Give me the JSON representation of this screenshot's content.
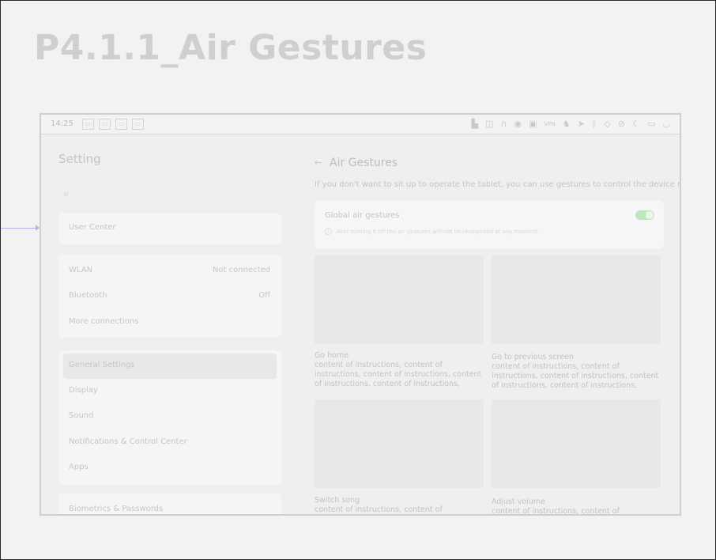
{
  "page_title": "P4.1.1_Air Gestures",
  "status_bar": {
    "time": "14:25",
    "notification_icons": [
      "notif-icon-1",
      "notif-icon-2",
      "notif-icon-3",
      "notif-icon-4"
    ],
    "system_icons": [
      {
        "name": "signal-sim-icon",
        "glyph": "▙"
      },
      {
        "name": "book-icon",
        "glyph": "◫"
      },
      {
        "name": "headphones-icon",
        "glyph": "∩"
      },
      {
        "name": "record-icon",
        "glyph": "◉"
      },
      {
        "name": "hd-icon",
        "glyph": "▣"
      },
      {
        "name": "vpn-icon",
        "glyph": "VPN"
      },
      {
        "name": "cat-icon",
        "glyph": "♞"
      },
      {
        "name": "location-icon",
        "glyph": "➤"
      },
      {
        "name": "bluetooth-icon",
        "glyph": "ᛒ"
      },
      {
        "name": "shield-icon",
        "glyph": "◇"
      },
      {
        "name": "alarm-off-icon",
        "glyph": "⊘"
      },
      {
        "name": "moon-icon",
        "glyph": "☾"
      },
      {
        "name": "battery-icon",
        "glyph": "▭"
      },
      {
        "name": "wifi-icon",
        "glyph": "◡"
      }
    ]
  },
  "sidebar": {
    "title": "Setting",
    "search_placeholder": "",
    "user_center": "User Center",
    "network": [
      {
        "label": "WLAN",
        "value": "Not connected"
      },
      {
        "label": "Bluetooth",
        "value": "Off"
      },
      {
        "label": "More connections",
        "value": ""
      }
    ],
    "general": [
      {
        "label": "General Settings",
        "active": true
      },
      {
        "label": "Display"
      },
      {
        "label": "Sound"
      },
      {
        "label": "Notifications & Control Center"
      },
      {
        "label": "Apps"
      }
    ],
    "security": [
      {
        "label": "Biometrics & Passwords"
      }
    ]
  },
  "main": {
    "back_glyph": "←",
    "title": "Air Gestures",
    "intro": "If you don't want to sit up to operate the tablet, you can use gestures to control the device remotely.",
    "global": {
      "title": "Global air gestures",
      "enabled": true,
      "note": "After turning it off the air gestures will not be recognized at any moment."
    },
    "gestures": [
      {
        "name": "Go home",
        "description": "content of instructions, content of instructions, content of instructions, content of instructions, content of instructions,"
      },
      {
        "name": "Go to previous screen",
        "description": "content of instructions, content of instructions, content of instructions, content of instructions, content of instructions,"
      },
      {
        "name": "Switch song",
        "description": "content of instructions, content of"
      },
      {
        "name": "Adjust volume",
        "description": "content of instructions, content of"
      }
    ]
  }
}
